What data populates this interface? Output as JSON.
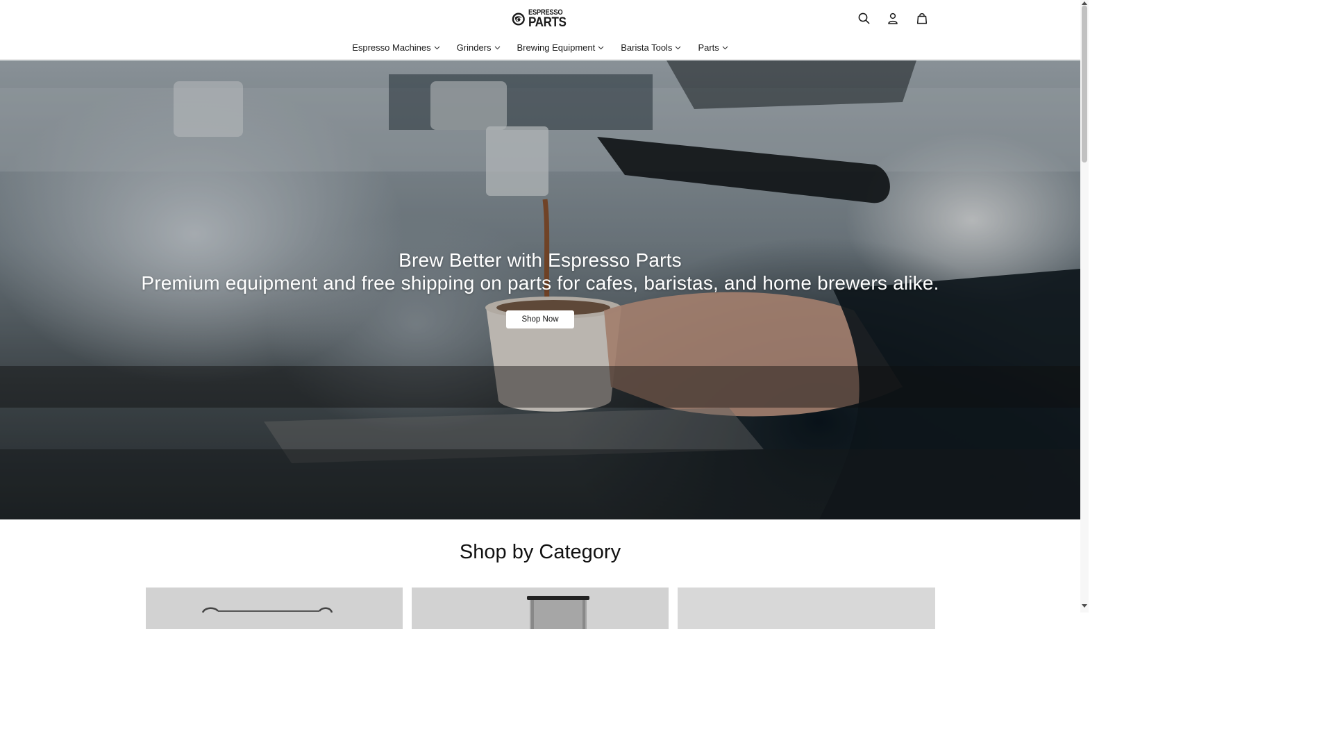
{
  "brand": {
    "logo_line1": "ESPRESSO",
    "logo_line2": "PARTS"
  },
  "header_icons": [
    "search-icon",
    "account-icon",
    "cart-bag-icon"
  ],
  "nav": {
    "items": [
      {
        "label": "Espresso Machines"
      },
      {
        "label": "Grinders"
      },
      {
        "label": "Brewing Equipment"
      },
      {
        "label": "Barista Tools"
      },
      {
        "label": "Parts"
      }
    ]
  },
  "hero": {
    "title": "Brew Better with Espresso Parts",
    "subtitle": "Premium equipment and free shipping on parts for cafes, baristas, and home brewers alike.",
    "cta_label": "Shop Now"
  },
  "categories": {
    "title": "Shop by Category"
  },
  "colors": {
    "text": "#111111",
    "card_bg": "#d2d2d2",
    "hero_overlay": "#2a3134"
  }
}
